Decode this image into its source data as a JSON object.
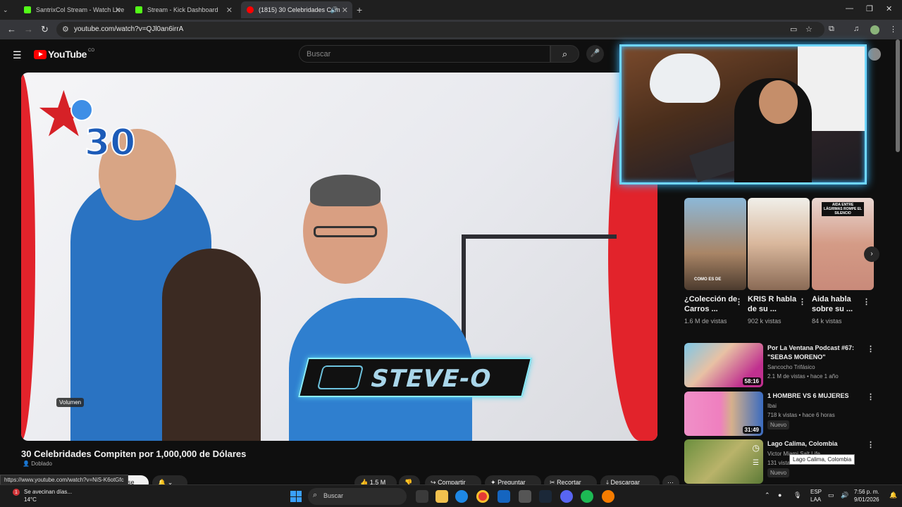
{
  "browser": {
    "tabs": [
      {
        "title": "SantrixCol Stream - Watch Live",
        "active": false
      },
      {
        "title": "Stream - Kick Dashboard",
        "active": false
      },
      {
        "title": "(1815) 30 Celebridades Com",
        "active": true
      }
    ],
    "url": "youtube.com/watch?v=QJl0an6irrA",
    "status_url": "https://www.youtube.com/watch?v=NiS-K6otGfc"
  },
  "youtube": {
    "country_code": "CO",
    "logo_text": "YouTube",
    "search_placeholder": "Buscar"
  },
  "video": {
    "title": "30 Celebridades Compiten por 1,000,000 de Dólares",
    "dubbed_label": "Doblado",
    "volume_tooltip": "Volumen",
    "badge_number": "30",
    "nameplate": "STEVE-O",
    "subscribe_partial": "nirse",
    "likes": "1.5 M",
    "share_label": "Compartir",
    "ask_label": "Preguntar",
    "clip_label": "Recortar",
    "download_label": "Descargar"
  },
  "shorts": [
    {
      "title": "¿Colección de Carros ...",
      "views": "1.6 M de vistas",
      "overlay": "COMO ES DE"
    },
    {
      "title": "KRIS R habla de su ...",
      "views": "902 k vistas",
      "overlay": ""
    },
    {
      "title": "Aida habla sobre su ...",
      "views": "84 k vistas",
      "overlay": "AIDA ENTRE LÁGRIMAS ROMPE EL SILENCIO"
    }
  ],
  "recommendations": [
    {
      "title": "Por La Ventana Podcast #67: \"SEBAS MORENO\"",
      "channel": "Sancocho Trifásico",
      "meta": "2.1 M de vistas • hace 1 año",
      "duration": "58:16",
      "badge": ""
    },
    {
      "title": "1 HOMBRE VS 6 MUJERES",
      "channel": "Ibai",
      "meta": "718 k vistas • hace 6 horas",
      "duration": "31:49",
      "badge": "Nuevo"
    },
    {
      "title": "Lago Calima, Colombia",
      "channel": "Victor Miami Salt Life",
      "meta": "131 vistas",
      "duration": "",
      "badge": "Nuevo"
    }
  ],
  "tooltip": "Lago Calima, Colombia",
  "taskbar": {
    "weather_line1": "Se avecinan días...",
    "weather_line2": "14°C",
    "weather_badge": "1",
    "search_label": "Buscar",
    "lang_line1": "ESP",
    "lang_line2": "LAA",
    "time": "7:56 p. m.",
    "date": "9/01/2026"
  }
}
